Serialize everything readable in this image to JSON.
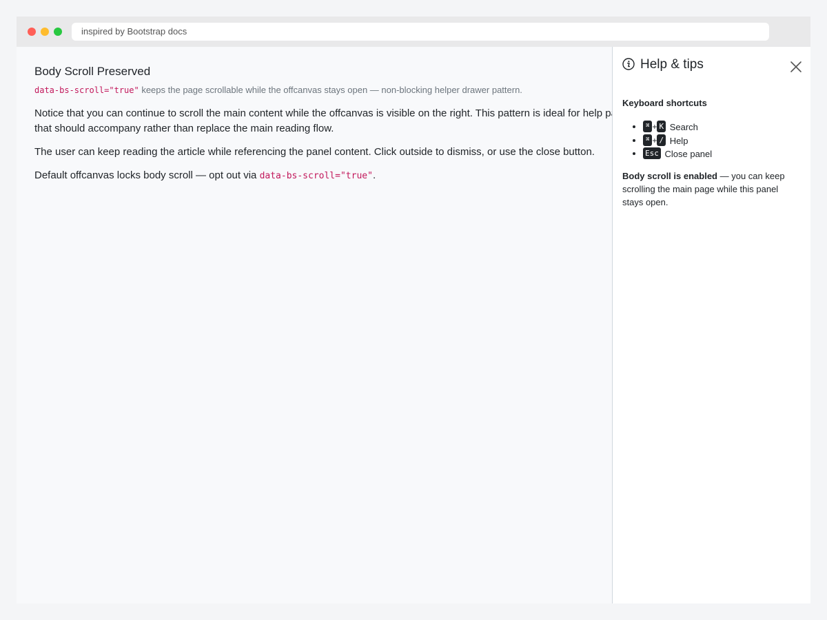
{
  "browser": {
    "address": "inspired by Bootstrap docs"
  },
  "main": {
    "title": "Body Scroll Preserved",
    "lead_code": "data-bs-scroll=\"true\"",
    "lead_text": " keeps the page scrollable while the offcanvas stays open — non-blocking helper drawer pattern.",
    "para1_line1": "Notice that you can continue to scroll the main content while the offcanvas is visible on the right. This pattern is ideal for help panels",
    "para1_line2": "that should accompany rather than replace the main reading flow.",
    "para2": "The user can keep reading the article while referencing the panel content. Click outside to dismiss, or use the close button.",
    "para3_text": "Default offcanvas locks body scroll — opt out via ",
    "para3_code": "data-bs-scroll=\"true\"",
    "para3_end": "."
  },
  "offcanvas": {
    "title": "Help & tips",
    "section_title": "Keyboard shortcuts",
    "shortcuts": [
      {
        "keys": [
          "⌘",
          "K"
        ],
        "label": "Search"
      },
      {
        "keys": [
          "⌘",
          "/"
        ],
        "label": "Help"
      },
      {
        "keys": [
          "Esc"
        ],
        "label": "Close panel"
      }
    ],
    "note_bold": "Body scroll is enabled",
    "note_text": " — you can keep scrolling the main page while this panel stays open."
  }
}
